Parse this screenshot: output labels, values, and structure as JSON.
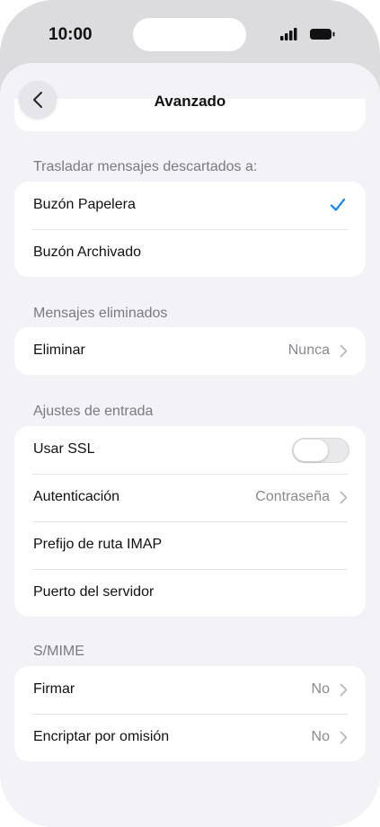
{
  "status_bar": {
    "time": "10:00",
    "icons": [
      "signal-icon",
      "battery-icon"
    ]
  },
  "nav": {
    "title": "Avanzado",
    "back_icon": "chevron-left-icon"
  },
  "sections": {
    "trash": {
      "header": "Trasladar mensajes descartados a:",
      "rows": [
        {
          "label": "Buzón Papelera",
          "selected": true
        },
        {
          "label": "Buzón Archivado",
          "selected": false
        }
      ]
    },
    "deleted": {
      "header": "Mensajes eliminados",
      "rows": [
        {
          "label": "Eliminar",
          "value": "Nunca"
        }
      ]
    },
    "incoming": {
      "header": "Ajustes de entrada",
      "rows": [
        {
          "label": "Usar SSL",
          "toggle_on": false
        },
        {
          "label": "Autenticación",
          "value": "Contraseña"
        },
        {
          "label": "Prefijo de ruta IMAP"
        },
        {
          "label": "Puerto del servidor"
        }
      ]
    },
    "smime": {
      "header": "S/MIME",
      "rows": [
        {
          "label": "Firmar",
          "value": "No"
        },
        {
          "label": "Encriptar por omisión",
          "value": "No"
        }
      ]
    }
  },
  "colors": {
    "accent": "#0a84ff",
    "background": "#f2f2f7",
    "card": "#ffffff",
    "secondary_text": "#8a8a8e"
  }
}
